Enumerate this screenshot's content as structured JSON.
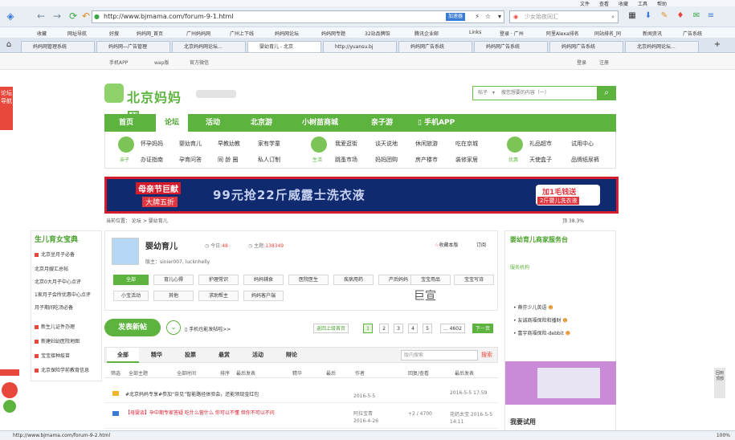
{
  "browser": {
    "menu": [
      "文件",
      "查看",
      "收藏",
      "工具",
      "帮助"
    ],
    "url": "http://www.bjmama.com/forum-9-1.html",
    "verify_label": "加速器",
    "search_placeholder": "少女始夜同汇",
    "bookmarks": [
      "收藏",
      "网址导航",
      "好搜",
      "妈妈网_首页",
      "广州妈妈网",
      "广州上下线",
      "妈妈网论坛",
      "妈妈网专题",
      "32站品牌馆",
      "腾讯企业邮",
      "Links",
      "登录 · 广州",
      "阿里Alexa排名",
      "同站排名_同",
      "新闻资讯",
      "广告系统"
    ],
    "tabs": [
      "妈妈网管理系统",
      "妈妈网—广告管理",
      "北京妈妈网论坛...",
      "婴幼育儿 - 北京",
      "http://yuansu.bj",
      "妈妈网广告系统",
      "妈妈网广告系统",
      "妈妈网广告系统",
      "北京妈妈网论坛..."
    ],
    "status_url": "http://www.bjmama.com/forum-9-2.html",
    "zoom": "100%"
  },
  "site": {
    "top_links": [
      "手机APP",
      "wap版",
      "官方微信"
    ],
    "login": "登录",
    "register": "注册",
    "side_ad": "论坛导航",
    "logo_text": "北京妈妈网",
    "search_type": "帖子",
    "search_placeholder": "搜您想要的内容（一）",
    "search_icon": "search-icon",
    "nav": [
      {
        "label": "首页",
        "active": false
      },
      {
        "label": "论坛",
        "active": true
      },
      {
        "label": "活动",
        "active": false
      },
      {
        "label": "北京游",
        "active": false
      },
      {
        "label": "小树苗商城",
        "active": false
      },
      {
        "label": "亲子游",
        "active": false
      },
      {
        "label": "手机APP",
        "active": false
      }
    ],
    "subnav": {
      "group1_label": "亲子",
      "group1": [
        "怀孕妈妈",
        "婴幼育儿",
        "早教幼教",
        "家有学童",
        "办证指南",
        "孕育问答",
        "同 龄 圈",
        "私人订制"
      ],
      "group2_label": "生活",
      "group2": [
        "我爱逛街",
        "谈天说地",
        "休闲旅游",
        "吃在京城",
        "跳蚤市场",
        "妈妈团购",
        "房产楼市",
        "装修家居"
      ],
      "group3_label": "优惠",
      "group3": [
        "礼品超市",
        "试用中心",
        "天使盒子",
        "品牌纸尿裤"
      ]
    },
    "banner": {
      "line1": "母亲节巨献",
      "line2": "大牌五折",
      "middle": "99元抢22斤威露士洗衣液",
      "right1": "加1毛钱送",
      "right2": "2斤婴儿洗衣液"
    },
    "breadcrumb": "当前位置：  论坛  >  婴幼育儿",
    "breadcrumb_right": "顶  38.3%"
  },
  "left_panel": {
    "title": "生儿育女宝典",
    "items": [
      {
        "text": "北京坐月子必备",
        "marker": true
      },
      {
        "text": "北京月嫂汇总帖",
        "marker": false
      },
      {
        "text": "北京0大月子中心点评",
        "marker": false
      },
      {
        "text": "1家月子会所优惠中心点评",
        "marker": false
      },
      {
        "text": "月子期间吃汤必备",
        "marker": false
      },
      {
        "text": "新生儿证件办理",
        "marker": true
      },
      {
        "text": "新建妇幼医院地图",
        "marker": true
      },
      {
        "text": "宝宝接种疫苗",
        "marker": true
      },
      {
        "text": "北京保险学前教育信息",
        "marker": true
      }
    ]
  },
  "forum": {
    "name": "婴幼育儿",
    "today_label": "今日",
    "today_value": "48",
    "topics_label": "主题",
    "topics_value": "138349",
    "mods": "版主：sinier007, lucknhelly",
    "fav": "收藏本版",
    "subscribe": "订阅",
    "categories": [
      {
        "label": "全部",
        "active": true
      },
      {
        "label": "育儿心得",
        "active": false
      },
      {
        "label": "护理常识",
        "active": false
      },
      {
        "label": "妈妈辅食",
        "active": false
      },
      {
        "label": "医院医生",
        "active": false
      },
      {
        "label": "疾病用药",
        "active": false
      },
      {
        "label": "产后妈妈",
        "active": false
      },
      {
        "label": "宝宝用品",
        "active": false
      },
      {
        "label": "宝宝写诗",
        "active": false
      },
      {
        "label": "小宝活动",
        "active": false
      },
      {
        "label": "其他",
        "active": false
      },
      {
        "label": "求助帮主",
        "active": false
      },
      {
        "label": "妈妈客户端",
        "active": false
      }
    ],
    "watermark": "巨宣"
  },
  "post_bar": {
    "post_label": "发表新帖",
    "mobile_label": "手机也能发帖啦>>",
    "pages": [
      "返回上级首页",
      "1",
      "2",
      "3",
      "4",
      "5",
      "... 4602",
      "下一页"
    ]
  },
  "list": {
    "tabs": [
      {
        "label": "全部",
        "active": true
      },
      {
        "label": "精华",
        "active": false
      },
      {
        "label": "投票",
        "active": false
      },
      {
        "label": "悬赏",
        "active": false
      },
      {
        "label": "活动",
        "active": false
      },
      {
        "label": "辩论",
        "active": false
      }
    ],
    "search_placeholder": "版内搜索",
    "search_btn": "搜索",
    "head": [
      "筛选",
      "全部主题",
      "全部时间",
      "排序",
      "最后发表",
      "精华",
      "最后",
      "作者",
      "回复/查看",
      "最后发表"
    ],
    "rows": [
      {
        "title": "#北京妈妈专享#参加“奈见”智能路径体验会，还能领现金红包",
        "red": false,
        "author": "",
        "date": "2016-5-5",
        "stat": "",
        "last": "2016-5-5 17:59"
      },
      {
        "title": "【母婴谈】孕中期专家答疑 吃什么营什么 你可以不懂 但你不可以不问",
        "red": true,
        "author": "阿拉宝青",
        "date": "2016-4-26",
        "stat": "+2 / 4700",
        "last": "花奶太宝 2016-5-5 14:11"
      }
    ]
  },
  "right_panel": {
    "title": "婴幼育儿商家服务台",
    "sub": "服务机构",
    "items": [
      "蒂芬少儿英语",
      "友诚商福保险和播财",
      "富宇商福保险-debbit"
    ],
    "trial_title": "我要试用"
  },
  "float_right": "回到顶部",
  "colors": {
    "brand": "#5cb33e",
    "accent": "#d51c2c",
    "banner_bg": "#0f2a6e"
  }
}
